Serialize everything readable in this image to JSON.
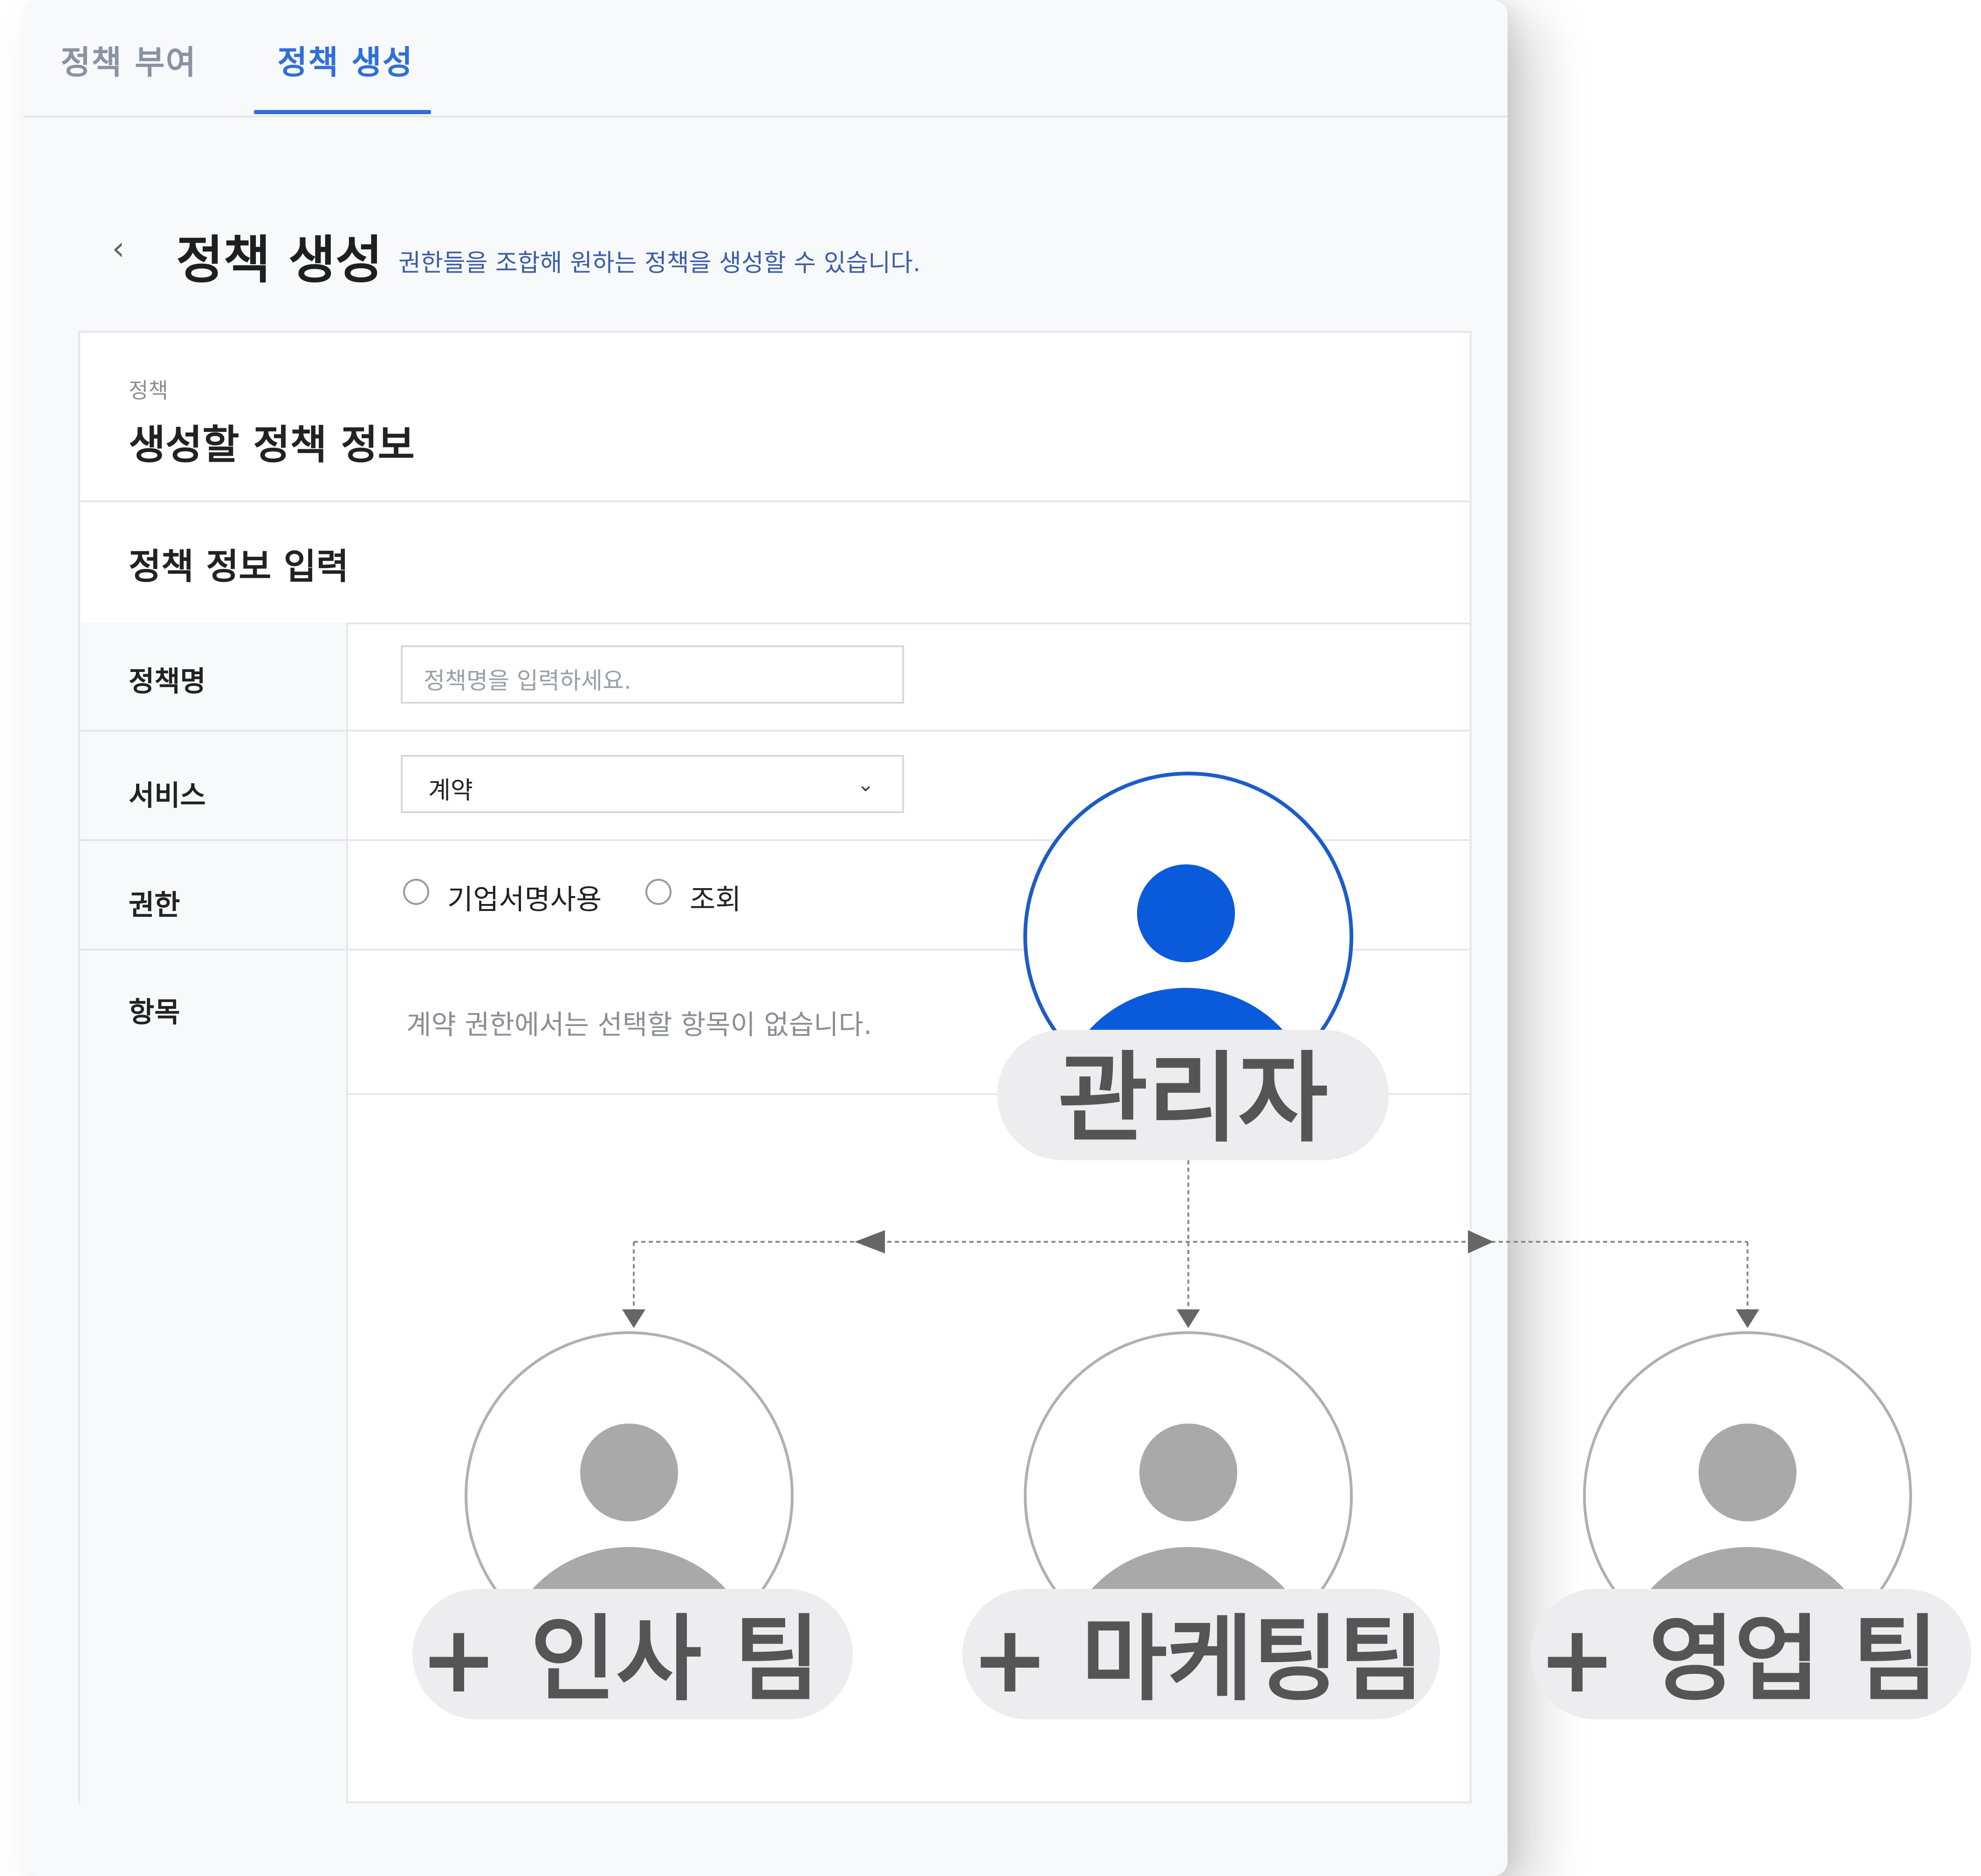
{
  "tabs": [
    {
      "label": "정책 부여",
      "active": false
    },
    {
      "label": "정책 생성",
      "active": true
    }
  ],
  "header": {
    "back_icon": "chevron-left-icon",
    "title": "정책 생성",
    "subtitle": "권한들을 조합해 원하는 정책을 생성할 수 있습니다."
  },
  "card": {
    "small_label": "정책",
    "title": "생성할 정책 정보",
    "section_title": "정책 정보 입력"
  },
  "form": {
    "name_label": "정책명",
    "name_placeholder": "정책명을 입력하세요.",
    "name_value": "",
    "service_label": "서비스",
    "service_value": "계약",
    "permission_label": "권한",
    "permission_options": [
      "기업서명사용",
      "조회"
    ],
    "items_label": "항목",
    "items_empty_message": "계약 권한에서는 선택할 항목이 없습니다."
  },
  "diagram": {
    "admin_label": "관리자",
    "teams": [
      "+ 인사 팀",
      "+ 마케팅팀",
      "+ 영업 팀"
    ],
    "colors": {
      "accent": "#2f6fd8",
      "admin_avatar": "#0a5adc",
      "team_avatar": "#a9a9a9",
      "pill_bg": "#ededf0",
      "pill_text": "#555555"
    }
  }
}
